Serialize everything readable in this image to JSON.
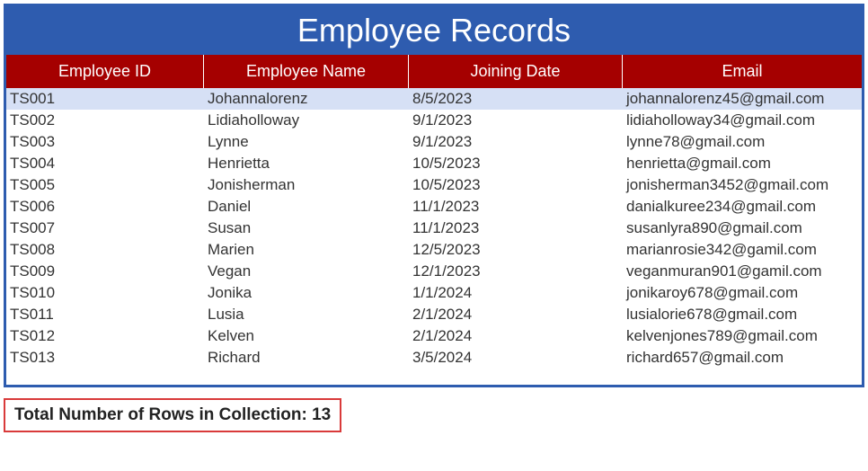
{
  "title": "Employee Records",
  "columns": [
    "Employee ID",
    "Employee Name",
    "Joining Date",
    "Email"
  ],
  "rows": [
    {
      "id": "TS001",
      "name": "Johannalorenz",
      "date": "8/5/2023",
      "email": "johannalorenz45@gmail.com",
      "selected": true
    },
    {
      "id": "TS002",
      "name": "Lidiaholloway",
      "date": "9/1/2023",
      "email": "lidiaholloway34@gmail.com",
      "selected": false
    },
    {
      "id": "TS003",
      "name": "Lynne",
      "date": "9/1/2023",
      "email": "lynne78@gmail.com",
      "selected": false
    },
    {
      "id": "TS004",
      "name": "Henrietta",
      "date": "10/5/2023",
      "email": "henrietta@gmail.com",
      "selected": false
    },
    {
      "id": "TS005",
      "name": "Jonisherman",
      "date": "10/5/2023",
      "email": "jonisherman3452@gmail.com",
      "selected": false
    },
    {
      "id": "TS006",
      "name": "Daniel",
      "date": "11/1/2023",
      "email": "danialkuree234@gmail.com",
      "selected": false
    },
    {
      "id": "TS007",
      "name": "Susan",
      "date": "11/1/2023",
      "email": "susanlyra890@gmail.com",
      "selected": false
    },
    {
      "id": "TS008",
      "name": "Marien",
      "date": "12/5/2023",
      "email": "marianrosie342@gamil.com",
      "selected": false
    },
    {
      "id": "TS009",
      "name": "Vegan",
      "date": "12/1/2023",
      "email": "veganmuran901@gamil.com",
      "selected": false
    },
    {
      "id": "TS010",
      "name": "Jonika",
      "date": "1/1/2024",
      "email": "jonikaroy678@gmail.com",
      "selected": false
    },
    {
      "id": "TS011",
      "name": "Lusia",
      "date": "2/1/2024",
      "email": "lusialorie678@gmail.com",
      "selected": false
    },
    {
      "id": "TS012",
      "name": "Kelven",
      "date": "2/1/2024",
      "email": "kelvenjones789@gmail.com",
      "selected": false
    },
    {
      "id": "TS013",
      "name": "Richard",
      "date": "3/5/2024",
      "email": "richard657@gmail.com",
      "selected": false
    }
  ],
  "total_label_prefix": "Total Number of Rows in Collection: ",
  "total_count": "13"
}
